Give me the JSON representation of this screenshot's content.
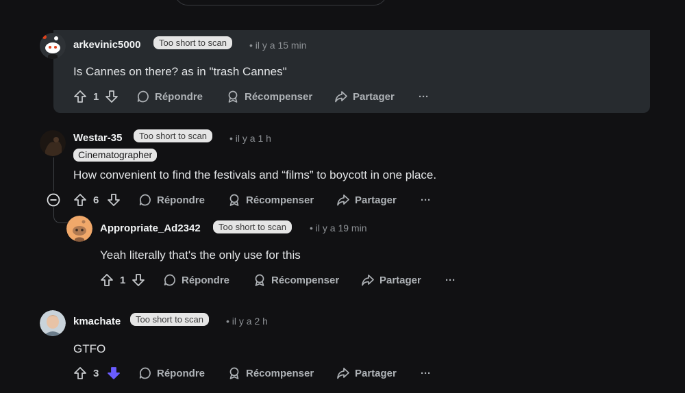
{
  "badge_text": "Too short to scan",
  "actions": {
    "reply": "Répondre",
    "award": "Récompenser",
    "share": "Partager",
    "more": "···"
  },
  "comments": [
    {
      "username": "arkevinic5000",
      "time": "• il y a 15 min",
      "text": "Is Cannes on there? as in \"trash Cannes\"",
      "votes": "1",
      "downvoted": false,
      "avatar": "snoo-white-avatar-icon"
    },
    {
      "username": "Westar-35",
      "time": "• il y a 1 h",
      "flair": "Cinematographer",
      "text": "How convenient to find the festivals and “films” to boycott in one place.",
      "votes": "6",
      "downvoted": false,
      "avatar": "dark-photo-avatar-icon"
    },
    {
      "username": "Appropriate_Ad2342",
      "time": "• il y a 19 min",
      "text": "Yeah literally that's the only use for this",
      "votes": "1",
      "downvoted": false,
      "avatar": "snoo-orange-avatar-icon"
    },
    {
      "username": "kmachate",
      "time": "• il y a 2 h",
      "text": "GTFO",
      "votes": "3",
      "downvoted": true,
      "avatar": "person-photo-avatar-icon"
    }
  ],
  "colors": {
    "background": "#111113",
    "highlight": "#272b2f",
    "downvote_active": "#6a5cff",
    "badge_bg": "#e5e5e5"
  }
}
